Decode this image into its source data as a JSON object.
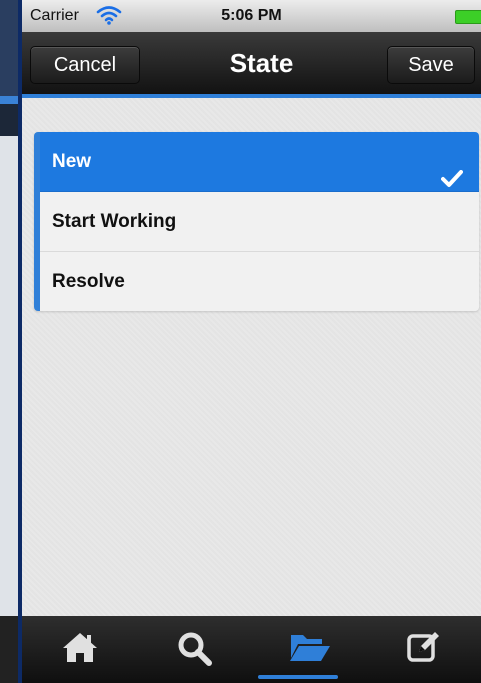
{
  "status_bar": {
    "carrier": "Carrier",
    "time": "5:06 PM",
    "icons": [
      "wifi-icon",
      "battery-icon"
    ]
  },
  "nav_bar": {
    "title": "State",
    "cancel_label": "Cancel",
    "save_label": "Save"
  },
  "state_list": {
    "items": [
      {
        "label": "New",
        "selected": true
      },
      {
        "label": "Start Working",
        "selected": false
      },
      {
        "label": "Resolve",
        "selected": false
      }
    ],
    "selected_icon": "checkmark-icon"
  },
  "tab_bar": {
    "tabs": [
      {
        "icon": "home-icon",
        "active": false
      },
      {
        "icon": "search-icon",
        "active": false
      },
      {
        "icon": "folder-open-icon",
        "active": true
      },
      {
        "icon": "compose-icon",
        "active": false
      }
    ]
  },
  "colors": {
    "accent": "#2f7fd8",
    "selected_row": "#1d79e0",
    "nav_background": "#1e1e1e",
    "tab_icon": "#e0e0e0",
    "battery": "#3ccf27"
  }
}
